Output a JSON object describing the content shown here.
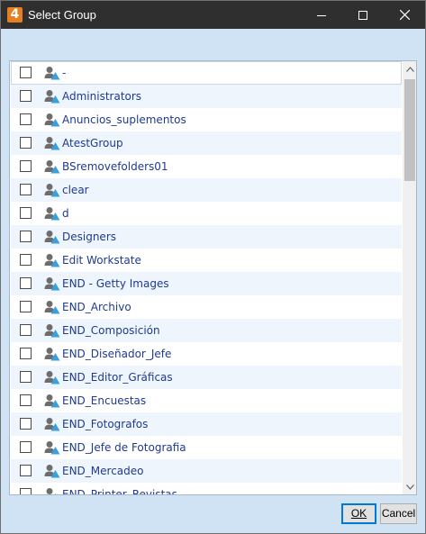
{
  "window": {
    "app_icon_glyph": "4",
    "title": "Select Group"
  },
  "list": {
    "items": [
      {
        "label": "-"
      },
      {
        "label": "Administrators"
      },
      {
        "label": "Anuncios_suplementos"
      },
      {
        "label": "AtestGroup"
      },
      {
        "label": "BSremovefolders01"
      },
      {
        "label": "clear"
      },
      {
        "label": "d"
      },
      {
        "label": "Designers"
      },
      {
        "label": "Edit Workstate"
      },
      {
        "label": "END - Getty Images"
      },
      {
        "label": "END_Archivo"
      },
      {
        "label": "END_Composición"
      },
      {
        "label": "END_Diseñador_Jefe"
      },
      {
        "label": "END_Editor_Gráficas"
      },
      {
        "label": "END_Encuestas"
      },
      {
        "label": "END_Fotografos"
      },
      {
        "label": "END_Jefe de Fotografia"
      },
      {
        "label": "END_Mercadeo"
      },
      {
        "label": "END_Printer_Revistas"
      }
    ]
  },
  "buttons": {
    "ok": "OK",
    "cancel": "Cancel"
  },
  "icons": {
    "group": "group-user-icon",
    "minimize": "minimize-icon",
    "maximize": "maximize-icon",
    "close": "close-icon",
    "scroll_up": "chevron-up-icon",
    "scroll_down": "chevron-down-icon"
  },
  "colors": {
    "titlebar": "#2f2f2f",
    "dialog_bg": "#cfe3f5",
    "row_alt": "#eef5fc",
    "label_text": "#1f3a8f",
    "app_icon": "#e67e22",
    "focus_border": "#0078d7"
  }
}
